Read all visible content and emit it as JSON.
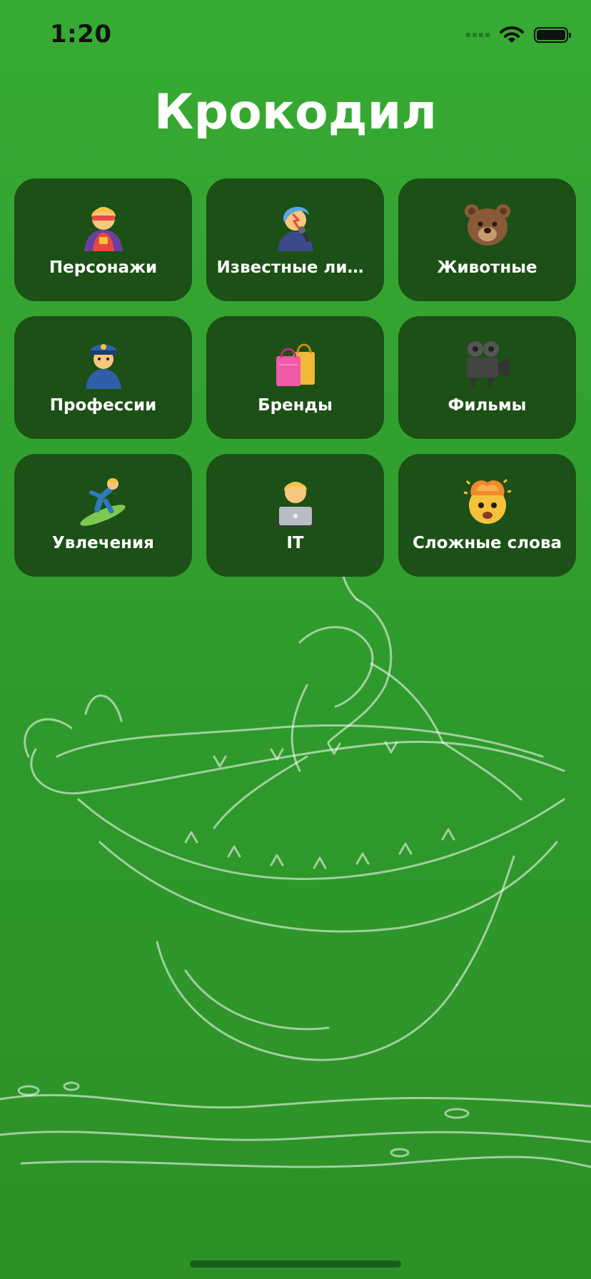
{
  "status_bar": {
    "time": "1:20",
    "icons": [
      "cellular-signal-icon",
      "wifi-icon",
      "battery-icon"
    ]
  },
  "title": "Крокодил",
  "colors": {
    "background": "#33a530",
    "card": "#1c5016",
    "text": "#ffffff"
  },
  "categories": [
    {
      "label": "Персонажи",
      "icon": "superhero-icon"
    },
    {
      "label": "Известные личности",
      "icon": "singer-icon"
    },
    {
      "label": "Животные",
      "icon": "bear-icon"
    },
    {
      "label": "Профессии",
      "icon": "police-officer-icon"
    },
    {
      "label": "Бренды",
      "icon": "shopping-bags-icon"
    },
    {
      "label": "Фильмы",
      "icon": "movie-camera-icon"
    },
    {
      "label": "Увлечения",
      "icon": "surfer-icon"
    },
    {
      "label": "IT",
      "icon": "technologist-icon"
    },
    {
      "label": "Сложные слова",
      "icon": "exploding-head-icon"
    }
  ],
  "background_illustration": "crocodile-line-art"
}
